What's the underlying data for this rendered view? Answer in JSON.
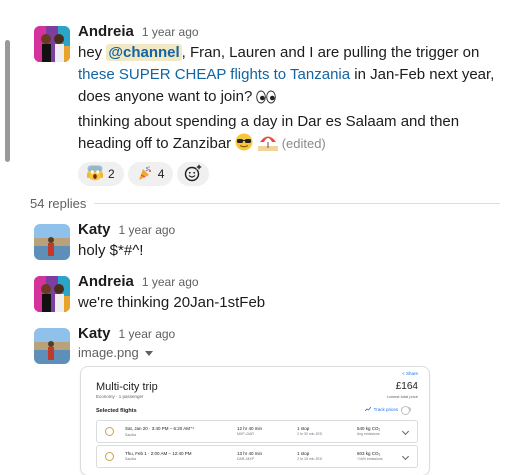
{
  "thread": {
    "parent": {
      "author": "Andreia",
      "time": "1 year ago",
      "text": {
        "p1": "hey ",
        "mention": "@channel",
        "p2": ", Fran, Lauren and I are pulling the trigger on ",
        "link": "these SUPER CHEAP flights to Tanzania",
        "p3": " in Jan-Feb next year, does anyone want to join?",
        "line2": "thinking about spending a day in Dar es Salaam and then heading off to Zanzibar",
        "edited": "(edited)"
      },
      "reactions": [
        {
          "icon": "scream-emoji",
          "count": "2"
        },
        {
          "icon": "party-emoji",
          "count": "4"
        }
      ]
    },
    "replies_label": "54 replies",
    "replies": [
      {
        "author": "Katy",
        "time": "1 year ago",
        "text": "holy $*#^!"
      },
      {
        "author": "Andreia",
        "time": "1 year ago",
        "text": "we're thinking 20Jan-1stFeb"
      },
      {
        "author": "Katy",
        "time": "1 year ago",
        "file": "image.png"
      }
    ]
  },
  "preview": {
    "title": "Multi-city trip",
    "subtitle": "Economy · 1 passenger",
    "share": "< Share",
    "price": "£164",
    "lowest": "Lowest total price",
    "selected": "Selected flights",
    "track": "Track prices",
    "flights": [
      {
        "date": "Sat, Jan 20 · 3:40 PM – 6:20 AM⁺¹",
        "airline": "Saudia",
        "duration": "12 hr 40 min",
        "route": "MXP–DAR",
        "stops": "1 stop",
        "layover": "2 hr 30 min JED",
        "co2": "540 kg CO₂",
        "emissions": "Avg emissions"
      },
      {
        "date": "Thu, Feb 1 · 2:00 AM – 12:40 PM",
        "airline": "Saudia",
        "duration": "13 hr 40 min",
        "route": "DAR–MXP",
        "stops": "1 stop",
        "layover": "2 hr 15 min JED",
        "co2": "603 kg CO₂",
        "emissions": "+16% emissions"
      }
    ]
  },
  "colors": {
    "link": "#1264a3",
    "mention_bg": "#f2e8c4",
    "reaction_bg": "#f0f0f0",
    "meta": "#616061"
  }
}
